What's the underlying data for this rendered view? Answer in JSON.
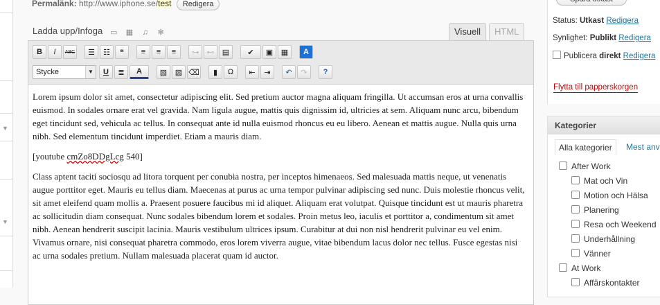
{
  "permalink": {
    "label": "Permalänk:",
    "base_url": "http://www.iphone.se/",
    "slug": "test",
    "edit_button": "Redigera"
  },
  "media": {
    "label": "Ladda upp/Infoga",
    "icons": [
      "image-icon",
      "video-icon",
      "audio-icon",
      "media-icon"
    ]
  },
  "editor_tabs": {
    "visual": "Visuell",
    "html": "HTML"
  },
  "toolbar": {
    "format_select": "Stycke",
    "row1": [
      {
        "name": "bold-button",
        "glyph": "B"
      },
      {
        "name": "italic-button",
        "glyph": "I"
      },
      {
        "name": "strikethrough-button",
        "glyph": "ABC"
      },
      {
        "name": "bullet-list-button",
        "glyph": "☰"
      },
      {
        "name": "numbered-list-button",
        "glyph": "☷"
      },
      {
        "name": "blockquote-button",
        "glyph": "❝"
      },
      {
        "name": "align-left-button",
        "glyph": "≡"
      },
      {
        "name": "align-center-button",
        "glyph": "≡"
      },
      {
        "name": "align-right-button",
        "glyph": "≡"
      },
      {
        "name": "insert-link-button",
        "glyph": "⊶"
      },
      {
        "name": "unlink-button",
        "glyph": "⊷"
      },
      {
        "name": "insert-more-button",
        "glyph": "▤"
      },
      {
        "name": "spellcheck-button",
        "glyph": "✔"
      },
      {
        "name": "fullscreen-button",
        "glyph": "▣"
      },
      {
        "name": "kitchen-sink-button",
        "glyph": "▦"
      },
      {
        "name": "app-store-button",
        "glyph": "A"
      }
    ],
    "row2": [
      {
        "name": "underline-button",
        "glyph": "U"
      },
      {
        "name": "justify-button",
        "glyph": "≣"
      },
      {
        "name": "text-color-button",
        "glyph": "A"
      },
      {
        "name": "paste-text-button",
        "glyph": "▧"
      },
      {
        "name": "paste-word-button",
        "glyph": "▨"
      },
      {
        "name": "remove-format-button",
        "glyph": "⌫"
      },
      {
        "name": "insert-media-button",
        "glyph": "▮"
      },
      {
        "name": "special-char-button",
        "glyph": "Ω"
      },
      {
        "name": "outdent-button",
        "glyph": "⇤"
      },
      {
        "name": "indent-button",
        "glyph": "⇥"
      },
      {
        "name": "undo-button",
        "glyph": "↶"
      },
      {
        "name": "redo-button",
        "glyph": "↷"
      },
      {
        "name": "help-button",
        "glyph": "?"
      }
    ]
  },
  "content": {
    "p1": "Lorem ipsum dolor sit amet, consectetur adipiscing elit. Sed pretium auctor magna aliquam fringilla. Ut accumsan eros at urna convallis euismod. In sodales ornare erat vel gravida. Nam ligula augue, mattis quis dignissim id, ultricies at sem. Aliquam nunc arcu, bibendum eget tincidunt sed, vehicula ac tellus. In consequat ante id nulla euismod rhoncus eu eu libero. Aenean et mattis augue. Nulla quis urna nibh. Sed elementum tincidunt imperdiet. Etiam a mauris diam.",
    "shortcode_start": "[youtube ",
    "shortcode_id": "cmZo8DDgLcg",
    "shortcode_end": " 540]",
    "p3": "Class aptent taciti sociosqu ad litora torquent per conubia nostra, per inceptos himenaeos. Sed malesuada mattis neque, ut venenatis augue porttitor eget. Mauris eu tellus diam. Maecenas at purus ac urna tempor pulvinar adipiscing sed nunc. Duis molestie rhoncus velit, sit amet eleifend quam mollis a. Praesent posuere faucibus mi id aliquet. Aliquam erat volutpat. Quisque tincidunt est ut mauris pharetra ac sollicitudin diam consequat. Nunc sodales bibendum lorem et sodales. Proin metus leo, iaculis et porttitor a, condimentum sit amet nibh. Aenean hendrerit suscipit lacinia. Mauris vestibulum ultrices ipsum. Curabitur at dui non nisl hendrerit pulvinar eu vel enim. Vivamus ornare, nisi consequat pharetra commodo, eros lorem viverra augue, vitae bibendum lacus dolor nec tellus. Fusce egestas nisi ac urna sodales pretium. Nullam malesuada placerat quam id auctor."
  },
  "publish": {
    "top_button": "Spara utkast",
    "status_label": "Status: ",
    "status_value": "Utkast",
    "visibility_label": "Synlighet: ",
    "visibility_value": "Publikt",
    "publish_label": "Publicera ",
    "publish_value": "direkt",
    "edit_link": "Redigera",
    "trash_link": "Flytta till papperskorgen"
  },
  "categories": {
    "title": "Kategorier",
    "tab_all": "Alla kategorier",
    "tab_most": "Mest anv",
    "items": [
      {
        "label": "After Work",
        "child": false
      },
      {
        "label": "Mat och Vin",
        "child": true
      },
      {
        "label": "Motion och Hälsa",
        "child": true
      },
      {
        "label": "Planering",
        "child": true
      },
      {
        "label": "Resa och Weekend",
        "child": true
      },
      {
        "label": "Underhållning",
        "child": true
      },
      {
        "label": "Vänner",
        "child": true
      },
      {
        "label": "At Work",
        "child": false
      },
      {
        "label": "Affärskontakter",
        "child": true
      }
    ]
  }
}
